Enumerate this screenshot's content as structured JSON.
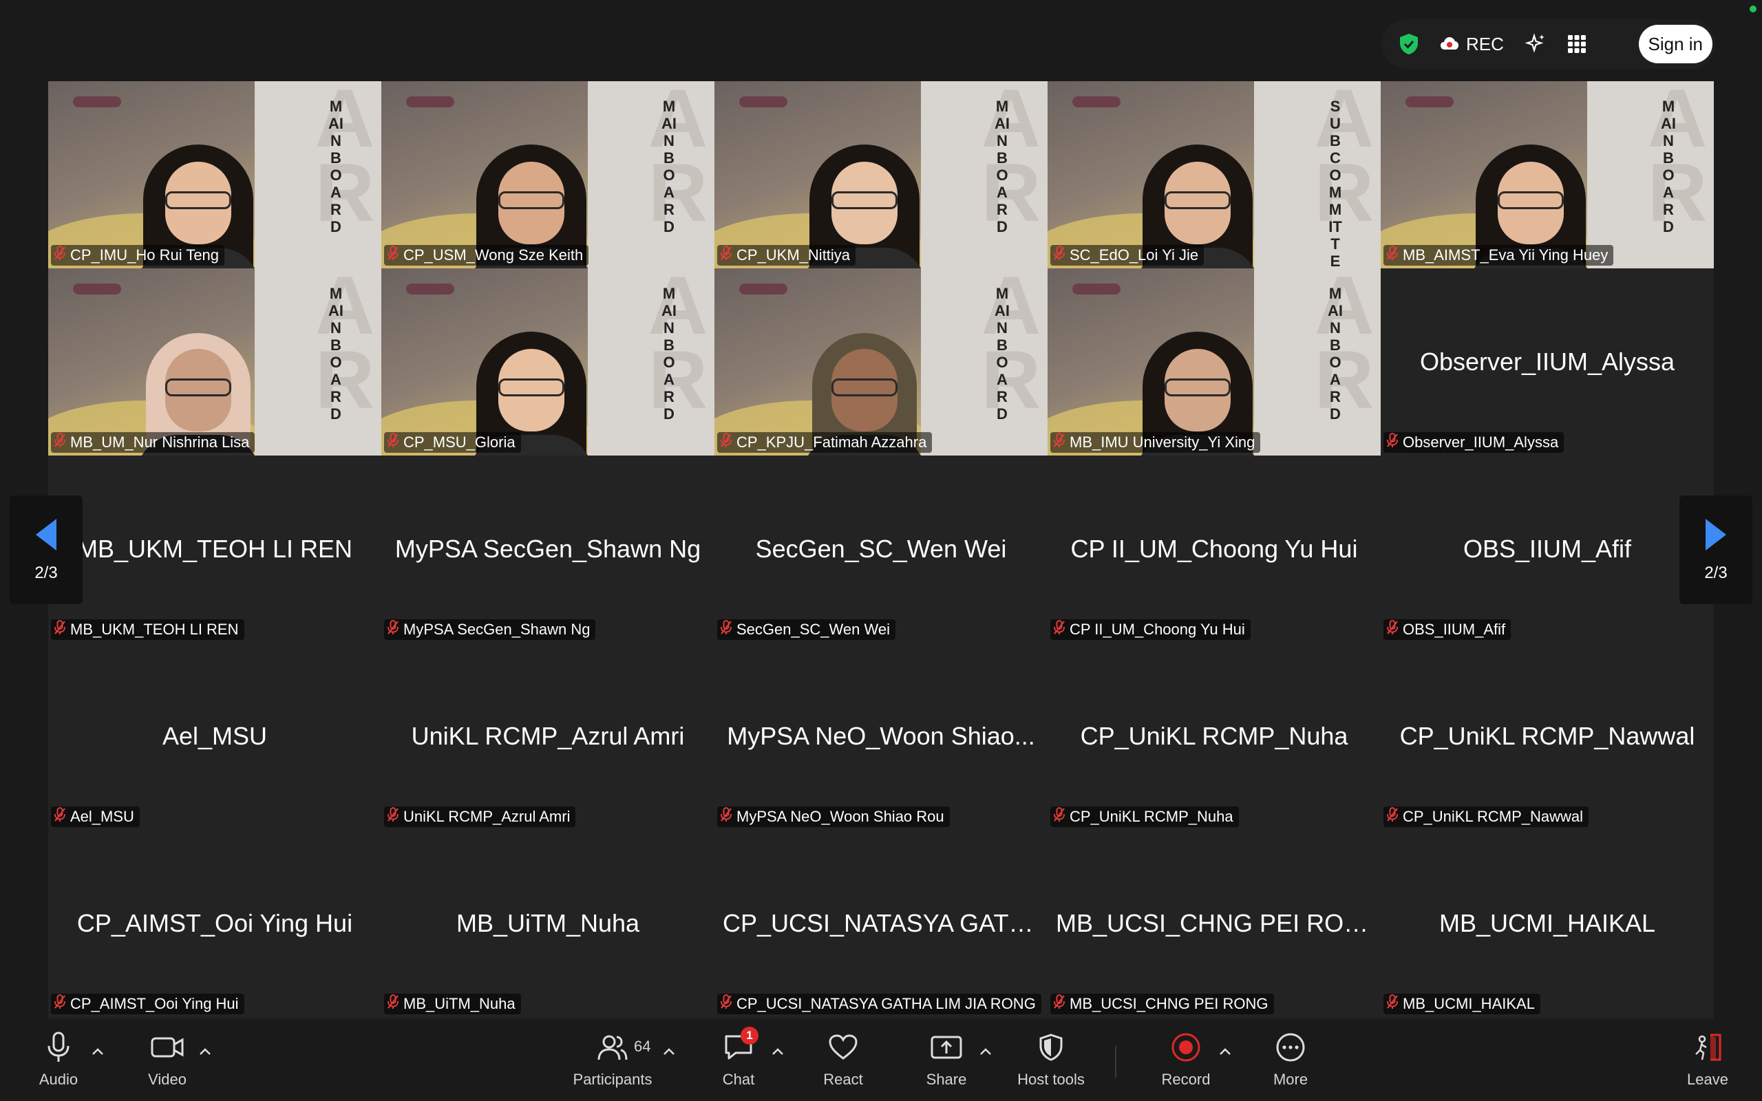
{
  "topbar": {
    "rec_label": "REC",
    "signin_label": "Sign in",
    "colors": {
      "shield": "#1ec35f",
      "status_dot": "#1ec35f"
    }
  },
  "tiles": [
    {
      "type": "video",
      "center_name": "",
      "label": "CP_IMU_Ho Rui Teng",
      "banner": "MAINBOARD"
    },
    {
      "type": "video",
      "center_name": "",
      "label": "CP_USM_Wong Sze Keith",
      "banner": "MAINBOARD"
    },
    {
      "type": "video",
      "center_name": "",
      "label": "CP_UKM_Nittiya",
      "banner": "MAINBOARD"
    },
    {
      "type": "video",
      "center_name": "",
      "label": "SC_EdO_Loi Yi Jie",
      "banner": "SUBCOMMITTEE"
    },
    {
      "type": "video",
      "center_name": "",
      "label": "MB_AIMST_Eva Yii Ying Huey",
      "banner": "MAINBOARD"
    },
    {
      "type": "video",
      "center_name": "",
      "label": "MB_UM_Nur Nishrina Lisa",
      "banner": "MAINBOARD"
    },
    {
      "type": "video",
      "center_name": "",
      "label": "CP_MSU_Gloria",
      "banner": "MAINBOARD"
    },
    {
      "type": "video",
      "center_name": "",
      "label": "CP_KPJU_Fatimah Azzahra",
      "banner": "MAINBOARD"
    },
    {
      "type": "video",
      "center_name": "",
      "label": "MB_IMU University_Yi Xing",
      "banner": "MAINBOARD"
    },
    {
      "type": "name",
      "center_name": "Observer_IIUM_Alyssa",
      "label": "Observer_IIUM_Alyssa"
    },
    {
      "type": "name",
      "center_name": "MB_UKM_TEOH LI REN",
      "label": "MB_UKM_TEOH LI REN"
    },
    {
      "type": "name",
      "center_name": "MyPSA SecGen_Shawn Ng",
      "label": "MyPSA SecGen_Shawn Ng"
    },
    {
      "type": "name",
      "center_name": "SecGen_SC_Wen Wei",
      "label": "SecGen_SC_Wen Wei"
    },
    {
      "type": "name",
      "center_name": "CP II_UM_Choong Yu Hui",
      "label": "CP II_UM_Choong Yu Hui"
    },
    {
      "type": "name",
      "center_name": "OBS_IIUM_Afif",
      "label": "OBS_IIUM_Afif"
    },
    {
      "type": "name",
      "center_name": "Ael_MSU",
      "label": "Ael_MSU"
    },
    {
      "type": "name",
      "center_name": "UniKL RCMP_Azrul Amri",
      "label": "UniKL RCMP_Azrul Amri"
    },
    {
      "type": "name",
      "center_name": "MyPSA NeO_Woon Shiao...",
      "label": "MyPSA NeO_Woon Shiao Rou"
    },
    {
      "type": "name",
      "center_name": "CP_UniKL RCMP_Nuha",
      "label": "CP_UniKL RCMP_Nuha"
    },
    {
      "type": "name",
      "center_name": "CP_UniKL RCMP_Nawwal",
      "label": "CP_UniKL RCMP_Nawwal"
    },
    {
      "type": "name",
      "center_name": "CP_AIMST_Ooi Ying Hui",
      "label": "CP_AIMST_Ooi Ying Hui"
    },
    {
      "type": "name",
      "center_name": "MB_UiTM_Nuha",
      "label": "MB_UiTM_Nuha"
    },
    {
      "type": "name",
      "center_name": "CP_UCSI_NATASYA GATH...",
      "label": "CP_UCSI_NATASYA GATHA LIM JIA RONG"
    },
    {
      "type": "name",
      "center_name": "MB_UCSI_CHNG PEI RONG",
      "label": "MB_UCSI_CHNG PEI RONG"
    },
    {
      "type": "name",
      "center_name": "MB_UCMI_HAIKAL",
      "label": "MB_UCMI_HAIKAL"
    }
  ],
  "pagination": {
    "prev_label": "2/3",
    "next_label": "2/3",
    "arrow_color": "#3d8bf5"
  },
  "toolbar": {
    "audio": "Audio",
    "video": "Video",
    "participants": "Participants",
    "participants_count": "64",
    "chat": "Chat",
    "chat_badge": "1",
    "react": "React",
    "share": "Share",
    "host_tools": "Host tools",
    "record": "Record",
    "more": "More",
    "leave": "Leave",
    "colors": {
      "record": "#e02828",
      "badge": "#e02828",
      "leave": "#e02828"
    }
  }
}
